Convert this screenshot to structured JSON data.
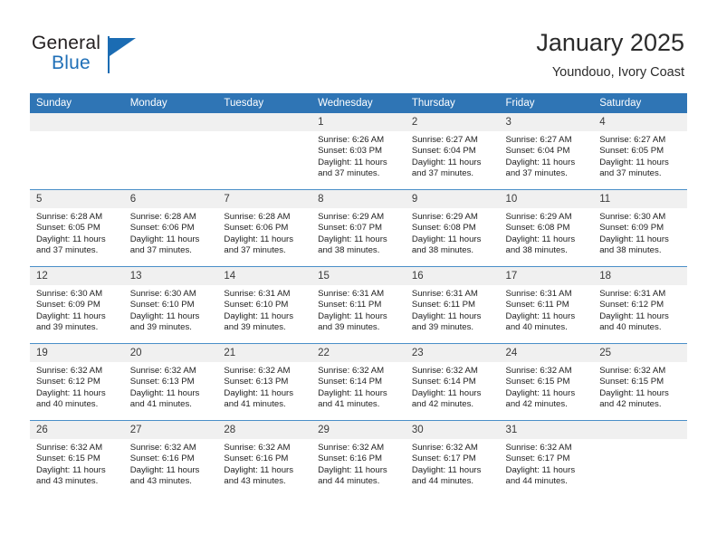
{
  "logo": {
    "word_top": "General",
    "word_bottom": "Blue",
    "accent_color": "#1b6cb3"
  },
  "header": {
    "title": "January 2025",
    "subtitle": "Youndouo, Ivory Coast"
  },
  "theme": {
    "header_blue": "#2f75b5",
    "row_line_blue": "#4a8fc8",
    "daynum_bg": "#f0f0f0"
  },
  "weekdays": [
    "Sunday",
    "Monday",
    "Tuesday",
    "Wednesday",
    "Thursday",
    "Friday",
    "Saturday"
  ],
  "weeks": [
    [
      {
        "day": "",
        "lines": []
      },
      {
        "day": "",
        "lines": []
      },
      {
        "day": "",
        "lines": []
      },
      {
        "day": "1",
        "lines": [
          "Sunrise: 6:26 AM",
          "Sunset: 6:03 PM",
          "Daylight: 11 hours",
          "and 37 minutes."
        ]
      },
      {
        "day": "2",
        "lines": [
          "Sunrise: 6:27 AM",
          "Sunset: 6:04 PM",
          "Daylight: 11 hours",
          "and 37 minutes."
        ]
      },
      {
        "day": "3",
        "lines": [
          "Sunrise: 6:27 AM",
          "Sunset: 6:04 PM",
          "Daylight: 11 hours",
          "and 37 minutes."
        ]
      },
      {
        "day": "4",
        "lines": [
          "Sunrise: 6:27 AM",
          "Sunset: 6:05 PM",
          "Daylight: 11 hours",
          "and 37 minutes."
        ]
      }
    ],
    [
      {
        "day": "5",
        "lines": [
          "Sunrise: 6:28 AM",
          "Sunset: 6:05 PM",
          "Daylight: 11 hours",
          "and 37 minutes."
        ]
      },
      {
        "day": "6",
        "lines": [
          "Sunrise: 6:28 AM",
          "Sunset: 6:06 PM",
          "Daylight: 11 hours",
          "and 37 minutes."
        ]
      },
      {
        "day": "7",
        "lines": [
          "Sunrise: 6:28 AM",
          "Sunset: 6:06 PM",
          "Daylight: 11 hours",
          "and 37 minutes."
        ]
      },
      {
        "day": "8",
        "lines": [
          "Sunrise: 6:29 AM",
          "Sunset: 6:07 PM",
          "Daylight: 11 hours",
          "and 38 minutes."
        ]
      },
      {
        "day": "9",
        "lines": [
          "Sunrise: 6:29 AM",
          "Sunset: 6:08 PM",
          "Daylight: 11 hours",
          "and 38 minutes."
        ]
      },
      {
        "day": "10",
        "lines": [
          "Sunrise: 6:29 AM",
          "Sunset: 6:08 PM",
          "Daylight: 11 hours",
          "and 38 minutes."
        ]
      },
      {
        "day": "11",
        "lines": [
          "Sunrise: 6:30 AM",
          "Sunset: 6:09 PM",
          "Daylight: 11 hours",
          "and 38 minutes."
        ]
      }
    ],
    [
      {
        "day": "12",
        "lines": [
          "Sunrise: 6:30 AM",
          "Sunset: 6:09 PM",
          "Daylight: 11 hours",
          "and 39 minutes."
        ]
      },
      {
        "day": "13",
        "lines": [
          "Sunrise: 6:30 AM",
          "Sunset: 6:10 PM",
          "Daylight: 11 hours",
          "and 39 minutes."
        ]
      },
      {
        "day": "14",
        "lines": [
          "Sunrise: 6:31 AM",
          "Sunset: 6:10 PM",
          "Daylight: 11 hours",
          "and 39 minutes."
        ]
      },
      {
        "day": "15",
        "lines": [
          "Sunrise: 6:31 AM",
          "Sunset: 6:11 PM",
          "Daylight: 11 hours",
          "and 39 minutes."
        ]
      },
      {
        "day": "16",
        "lines": [
          "Sunrise: 6:31 AM",
          "Sunset: 6:11 PM",
          "Daylight: 11 hours",
          "and 39 minutes."
        ]
      },
      {
        "day": "17",
        "lines": [
          "Sunrise: 6:31 AM",
          "Sunset: 6:11 PM",
          "Daylight: 11 hours",
          "and 40 minutes."
        ]
      },
      {
        "day": "18",
        "lines": [
          "Sunrise: 6:31 AM",
          "Sunset: 6:12 PM",
          "Daylight: 11 hours",
          "and 40 minutes."
        ]
      }
    ],
    [
      {
        "day": "19",
        "lines": [
          "Sunrise: 6:32 AM",
          "Sunset: 6:12 PM",
          "Daylight: 11 hours",
          "and 40 minutes."
        ]
      },
      {
        "day": "20",
        "lines": [
          "Sunrise: 6:32 AM",
          "Sunset: 6:13 PM",
          "Daylight: 11 hours",
          "and 41 minutes."
        ]
      },
      {
        "day": "21",
        "lines": [
          "Sunrise: 6:32 AM",
          "Sunset: 6:13 PM",
          "Daylight: 11 hours",
          "and 41 minutes."
        ]
      },
      {
        "day": "22",
        "lines": [
          "Sunrise: 6:32 AM",
          "Sunset: 6:14 PM",
          "Daylight: 11 hours",
          "and 41 minutes."
        ]
      },
      {
        "day": "23",
        "lines": [
          "Sunrise: 6:32 AM",
          "Sunset: 6:14 PM",
          "Daylight: 11 hours",
          "and 42 minutes."
        ]
      },
      {
        "day": "24",
        "lines": [
          "Sunrise: 6:32 AM",
          "Sunset: 6:15 PM",
          "Daylight: 11 hours",
          "and 42 minutes."
        ]
      },
      {
        "day": "25",
        "lines": [
          "Sunrise: 6:32 AM",
          "Sunset: 6:15 PM",
          "Daylight: 11 hours",
          "and 42 minutes."
        ]
      }
    ],
    [
      {
        "day": "26",
        "lines": [
          "Sunrise: 6:32 AM",
          "Sunset: 6:15 PM",
          "Daylight: 11 hours",
          "and 43 minutes."
        ]
      },
      {
        "day": "27",
        "lines": [
          "Sunrise: 6:32 AM",
          "Sunset: 6:16 PM",
          "Daylight: 11 hours",
          "and 43 minutes."
        ]
      },
      {
        "day": "28",
        "lines": [
          "Sunrise: 6:32 AM",
          "Sunset: 6:16 PM",
          "Daylight: 11 hours",
          "and 43 minutes."
        ]
      },
      {
        "day": "29",
        "lines": [
          "Sunrise: 6:32 AM",
          "Sunset: 6:16 PM",
          "Daylight: 11 hours",
          "and 44 minutes."
        ]
      },
      {
        "day": "30",
        "lines": [
          "Sunrise: 6:32 AM",
          "Sunset: 6:17 PM",
          "Daylight: 11 hours",
          "and 44 minutes."
        ]
      },
      {
        "day": "31",
        "lines": [
          "Sunrise: 6:32 AM",
          "Sunset: 6:17 PM",
          "Daylight: 11 hours",
          "and 44 minutes."
        ]
      },
      {
        "day": "",
        "lines": []
      }
    ]
  ]
}
